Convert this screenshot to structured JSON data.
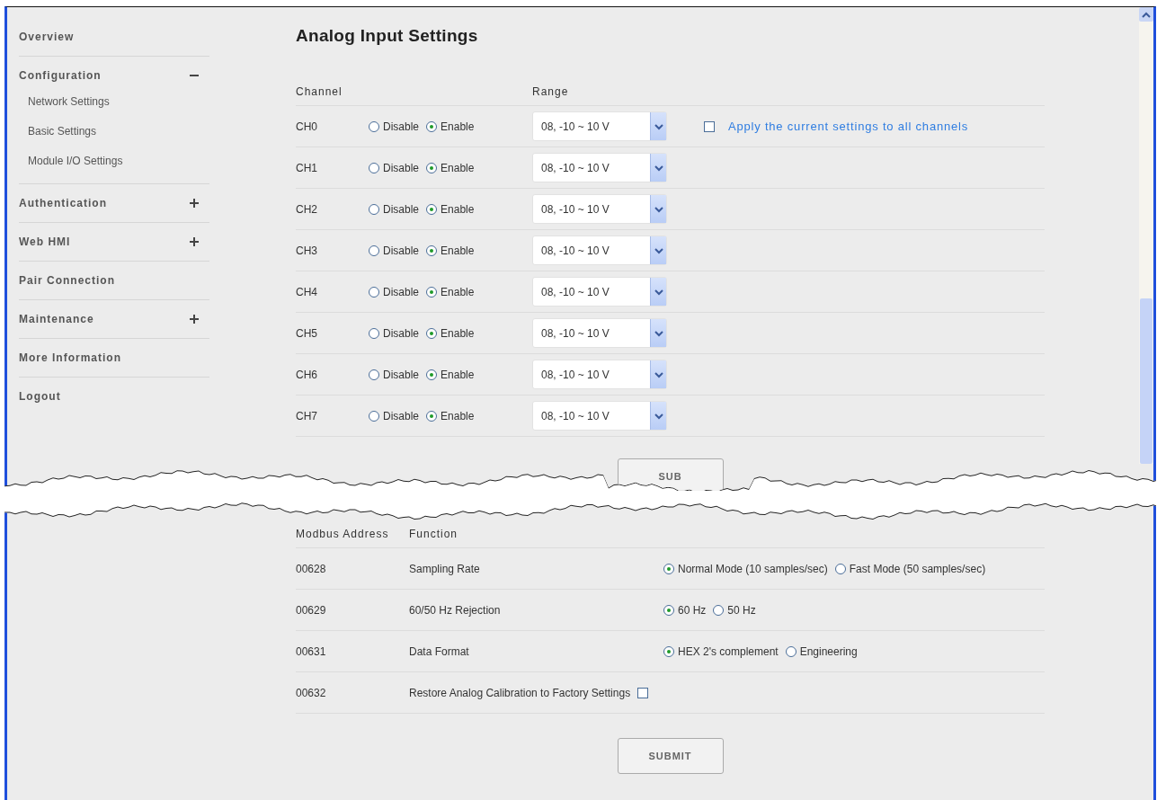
{
  "sidebar": {
    "items": [
      {
        "label": "Overview",
        "kind": "link"
      },
      {
        "label": "Configuration",
        "kind": "group",
        "expanded": true,
        "children": [
          {
            "label": "Network Settings"
          },
          {
            "label": "Basic Settings"
          },
          {
            "label": "Module I/O Settings"
          }
        ]
      },
      {
        "label": "Authentication",
        "kind": "group",
        "expanded": false
      },
      {
        "label": "Web HMI",
        "kind": "group",
        "expanded": false
      },
      {
        "label": "Pair Connection",
        "kind": "link"
      },
      {
        "label": "Maintenance",
        "kind": "group",
        "expanded": false
      },
      {
        "label": "More Information",
        "kind": "link"
      },
      {
        "label": "Logout",
        "kind": "link"
      }
    ]
  },
  "page_title": "Analog Input Settings",
  "channel_table": {
    "columns": [
      "Channel",
      "Range"
    ],
    "apply_all": {
      "label": "Apply the current settings to all channels",
      "checked": false
    },
    "rows": [
      {
        "name": "CH0",
        "options": [
          {
            "label": "Disable",
            "selected": false
          },
          {
            "label": "Enable",
            "selected": true
          }
        ],
        "range": "08, -10 ~ 10 V"
      },
      {
        "name": "CH1",
        "options": [
          {
            "label": "Disable",
            "selected": false
          },
          {
            "label": "Enable",
            "selected": true
          }
        ],
        "range": "08, -10 ~ 10 V"
      },
      {
        "name": "CH2",
        "options": [
          {
            "label": "Disable",
            "selected": false
          },
          {
            "label": "Enable",
            "selected": true
          }
        ],
        "range": "08, -10 ~ 10 V"
      },
      {
        "name": "CH3",
        "options": [
          {
            "label": "Disable",
            "selected": false
          },
          {
            "label": "Enable",
            "selected": true
          }
        ],
        "range": "08, -10 ~ 10 V"
      },
      {
        "name": "CH4",
        "options": [
          {
            "label": "Disable",
            "selected": false
          },
          {
            "label": "Enable",
            "selected": true
          }
        ],
        "range": "08, -10 ~ 10 V"
      },
      {
        "name": "CH5",
        "options": [
          {
            "label": "Disable",
            "selected": false
          },
          {
            "label": "Enable",
            "selected": true
          }
        ],
        "range": "08, -10 ~ 10 V"
      },
      {
        "name": "CH6",
        "options": [
          {
            "label": "Disable",
            "selected": false
          },
          {
            "label": "Enable",
            "selected": true
          }
        ],
        "range": "08, -10 ~ 10 V"
      },
      {
        "name": "CH7",
        "options": [
          {
            "label": "Disable",
            "selected": false
          },
          {
            "label": "Enable",
            "selected": true
          }
        ],
        "range": "08, -10 ~ 10 V"
      }
    ],
    "submit": "SUB"
  },
  "settings_table": {
    "columns": [
      "Modbus Address",
      "Function"
    ],
    "rows": [
      {
        "address": "00628",
        "function": "Sampling Rate",
        "kind": "radio",
        "options": [
          {
            "label": "Normal Mode (10 samples/sec)",
            "selected": true
          },
          {
            "label": "Fast Mode (50 samples/sec)",
            "selected": false
          }
        ]
      },
      {
        "address": "00629",
        "function": "60/50 Hz Rejection",
        "kind": "radio",
        "options": [
          {
            "label": "60 Hz",
            "selected": true
          },
          {
            "label": "50 Hz",
            "selected": false
          }
        ]
      },
      {
        "address": "00631",
        "function": "Data Format",
        "kind": "radio",
        "options": [
          {
            "label": "HEX 2's complement",
            "selected": true
          },
          {
            "label": "Engineering",
            "selected": false
          }
        ]
      },
      {
        "address": "00632",
        "function": "Restore Analog Calibration to Factory Settings",
        "kind": "checkbox",
        "checked": false
      }
    ],
    "submit": "SUBMIT"
  }
}
